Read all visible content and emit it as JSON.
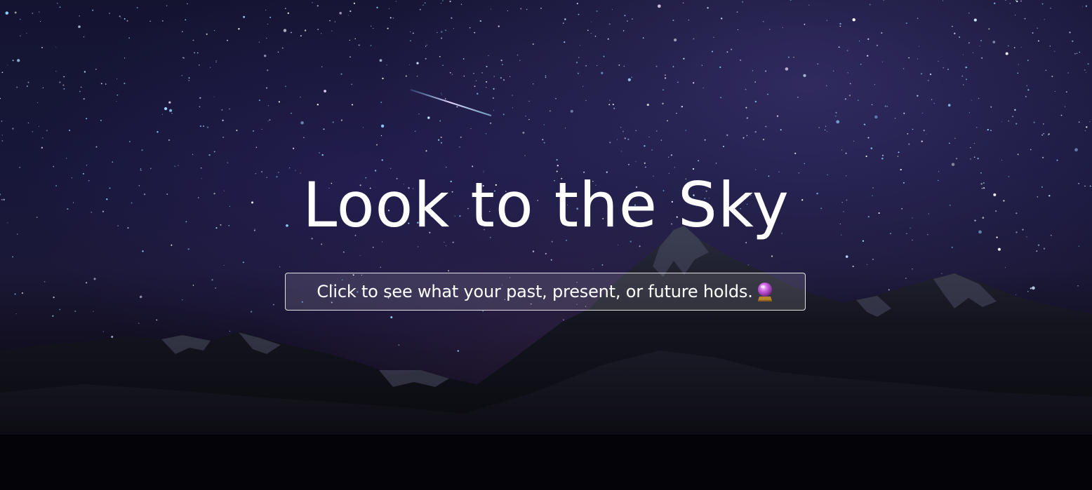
{
  "hero": {
    "title": "Look to the Sky",
    "button_label": "Click to see what your past, present, or future holds.",
    "button_icon": "crystal-ball-icon"
  },
  "colors": {
    "sky_top": "#141431",
    "sky_mid": "#1b1837",
    "ground": "#060509",
    "text": "#ffffff",
    "crystal_ball": "#c45ad8"
  }
}
